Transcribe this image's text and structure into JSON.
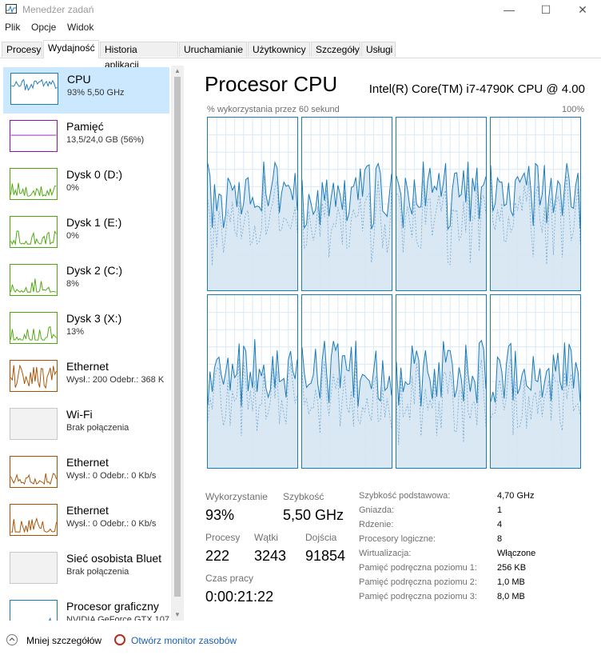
{
  "window": {
    "title": "Menedżer zadań"
  },
  "menu": [
    "Plik",
    "Opcje",
    "Widok"
  ],
  "tabs": [
    "Procesy",
    "Wydajność",
    "Historia aplikacji",
    "Uruchamianie",
    "Użytkownicy",
    "Szczegóły",
    "Usługi"
  ],
  "active_tab": "Wydajność",
  "sidebar": [
    {
      "name": "CPU",
      "sub": "93%  5,50 GHz",
      "color": "#1a7bb9",
      "selected": true
    },
    {
      "name": "Pamięć",
      "sub": "13,5/24,0 GB (56%)",
      "color": "#8b12ae"
    },
    {
      "name": "Dysk 0 (D:)",
      "sub": "0%",
      "color": "#4da60c"
    },
    {
      "name": "Dysk 1 (E:)",
      "sub": "0%",
      "color": "#4da60c"
    },
    {
      "name": "Dysk 2 (C:)",
      "sub": "8%",
      "color": "#4da60c"
    },
    {
      "name": "Dysk 3 (X:)",
      "sub": "13%",
      "color": "#4da60c"
    },
    {
      "name": "Ethernet",
      "sub": "Wysł.: 200  Odebr.: 368 K",
      "color": "#a74f01"
    },
    {
      "name": "Wi-Fi",
      "sub": "Brak połączenia",
      "color": "#c8c8c8"
    },
    {
      "name": "Ethernet",
      "sub": "Wysł.: 0  Odebr.: 0 Kb/s",
      "color": "#a74f01"
    },
    {
      "name": "Ethernet",
      "sub": "Wysł.: 0  Odebr.: 0 Kb/s",
      "color": "#a74f01"
    },
    {
      "name": "Sieć osobista Bluet",
      "sub": "Brak połączenia",
      "color": "#c8c8c8"
    },
    {
      "name": "Procesor graficzny",
      "sub": "NVIDIA GeForce GTX 107",
      "color": "#1a7bb9"
    }
  ],
  "main": {
    "title": "Procesor CPU",
    "model": "Intel(R) Core(TM) i7-4790K CPU @ 4.00",
    "util_label": "% wykorzystania przez 60 sekund",
    "util_max": "100%"
  },
  "stats": {
    "util_label": "Wykorzystanie",
    "util_value": "93%",
    "speed_label": "Szybkość",
    "speed_value": "5,50 GHz",
    "proc_label": "Procesy",
    "proc_value": "222",
    "threads_label": "Wątki",
    "threads_value": "3243",
    "handles_label": "Dojścia",
    "handles_value": "91854",
    "uptime_label": "Czas pracy",
    "uptime_value": "0:00:21:22"
  },
  "details": [
    {
      "key": "Szybkość podstawowa:",
      "value": "4,70 GHz"
    },
    {
      "key": "Gniazda:",
      "value": "1"
    },
    {
      "key": "Rdzenie:",
      "value": "4"
    },
    {
      "key": "Procesory logiczne:",
      "value": "8"
    },
    {
      "key": "Wirtualizacja:",
      "value": "Włączone"
    },
    {
      "key": "Pamięć podręczna poziomu 1:",
      "value": "256 KB"
    },
    {
      "key": "Pamięć podręczna poziomu 2:",
      "value": "1,0 MB"
    },
    {
      "key": "Pamięć podręczna poziomu 3:",
      "value": "8,0 MB"
    }
  ],
  "footer": {
    "fewer": "Mniej szczegółów",
    "monitor": "Otwórz monitor zasobów"
  }
}
